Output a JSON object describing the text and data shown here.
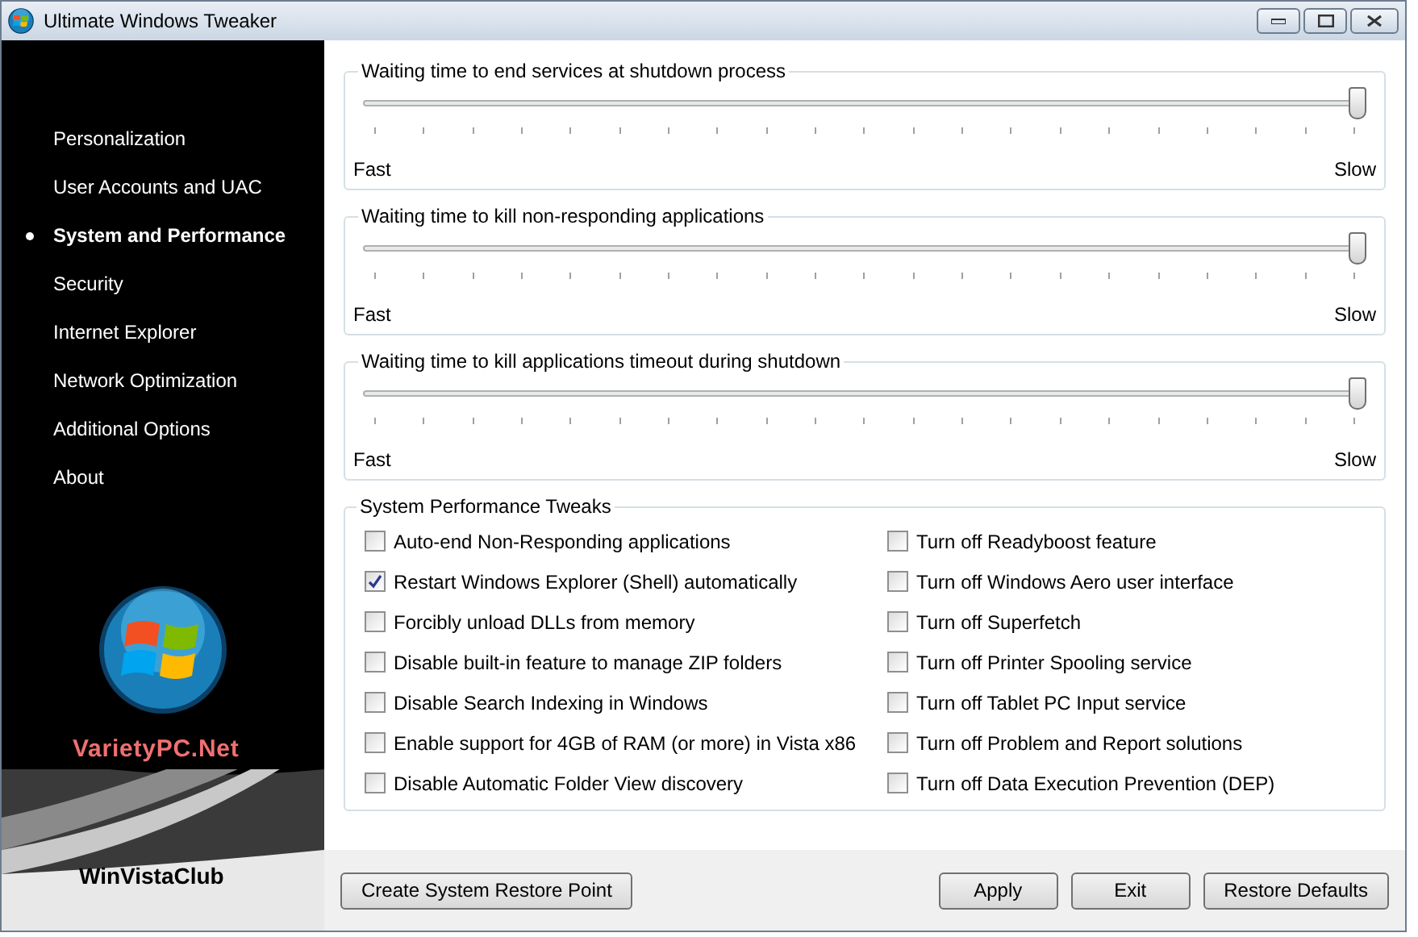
{
  "window": {
    "title": "Ultimate Windows Tweaker"
  },
  "sidebar": {
    "items": [
      {
        "label": "Personalization",
        "selected": false
      },
      {
        "label": "User Accounts and UAC",
        "selected": false
      },
      {
        "label": "System and Performance",
        "selected": true
      },
      {
        "label": "Security",
        "selected": false
      },
      {
        "label": "Internet Explorer",
        "selected": false
      },
      {
        "label": "Network Optimization",
        "selected": false
      },
      {
        "label": "Additional Options",
        "selected": false
      },
      {
        "label": "About",
        "selected": false
      }
    ],
    "brand": "VarietyPC.Net",
    "club": "WinVistaClub"
  },
  "sliders": [
    {
      "title": "Waiting time to end services at shutdown process",
      "level": 1,
      "min_label": "Fast",
      "max_label": "Slow"
    },
    {
      "title": "Waiting time to kill non-responding applications",
      "level": 1,
      "min_label": "Fast",
      "max_label": "Slow"
    },
    {
      "title": "Waiting time to kill applications timeout during shutdown",
      "level": 1,
      "min_label": "Fast",
      "max_label": "Slow"
    }
  ],
  "tweaks": {
    "title": "System Performance Tweaks",
    "columns": [
      [
        {
          "label": "Auto-end Non-Responding applications",
          "checked": false
        },
        {
          "label": "Restart Windows Explorer (Shell) automatically",
          "checked": true
        },
        {
          "label": "Forcibly unload DLLs from memory",
          "checked": false
        },
        {
          "label": "Disable built-in feature to manage ZIP folders",
          "checked": false
        },
        {
          "label": "Disable Search Indexing in Windows",
          "checked": false
        },
        {
          "label": "Enable support for 4GB of RAM (or more) in Vista x86",
          "checked": false
        },
        {
          "label": "Disable Automatic Folder View discovery",
          "checked": false
        }
      ],
      [
        {
          "label": "Turn off Readyboost feature",
          "checked": false
        },
        {
          "label": "Turn off Windows Aero user interface",
          "checked": false
        },
        {
          "label": "Turn off Superfetch",
          "checked": false
        },
        {
          "label": "Turn off Printer Spooling service",
          "checked": false
        },
        {
          "label": "Turn off Tablet PC Input service",
          "checked": false
        },
        {
          "label": "Turn off Problem and Report solutions",
          "checked": false
        },
        {
          "label": "Turn off Data Execution Prevention (DEP)",
          "checked": false
        }
      ]
    ]
  },
  "buttons": {
    "left": [
      "Create System Restore Point"
    ],
    "right": [
      "Apply",
      "Exit",
      "Restore Defaults"
    ]
  }
}
